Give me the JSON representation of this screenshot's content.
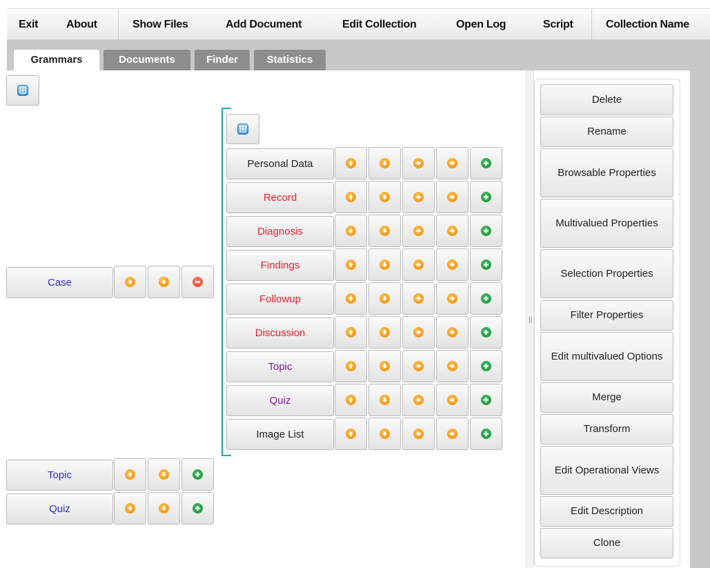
{
  "menu": {
    "items": [
      "Exit",
      "About",
      "Show Files",
      "Add Document",
      "Edit Collection",
      "Open Log",
      "Script",
      "Collection Name"
    ]
  },
  "tabs": [
    "Grammars",
    "Documents",
    "Finder",
    "Statistics"
  ],
  "active_tab": "Grammars",
  "root_nodes": [
    {
      "label": "Case",
      "color": "#2d2dcc",
      "actions": [
        "move-up",
        "move-down",
        "remove"
      ]
    },
    {
      "label": "Topic",
      "color": "#2d2dcc",
      "actions": [
        "move-up",
        "move-down",
        "add"
      ]
    },
    {
      "label": "Quiz",
      "color": "#2d2dcc",
      "actions": [
        "move-up",
        "move-down",
        "add"
      ]
    }
  ],
  "child_nodes": [
    {
      "label": "Personal Data",
      "color": "#222222"
    },
    {
      "label": "Record",
      "color": "#e8212a"
    },
    {
      "label": "Diagnosis",
      "color": "#e8212a"
    },
    {
      "label": "Findings",
      "color": "#e8212a"
    },
    {
      "label": "Followup",
      "color": "#e8212a"
    },
    {
      "label": "Discussion",
      "color": "#e8212a"
    },
    {
      "label": "Topic",
      "color": "#7c1fa0"
    },
    {
      "label": "Quiz",
      "color": "#7c1fa0"
    },
    {
      "label": "Image List",
      "color": "#222222"
    }
  ],
  "child_actions": [
    "move-up",
    "move-down",
    "move-left",
    "move-right",
    "add"
  ],
  "side_buttons": [
    "Delete",
    "Rename",
    "Browsable Properties",
    "Multivalued Properties",
    "Selection Properties",
    "Filter Properties",
    "Edit multivalued Options",
    "Merge",
    "Transform",
    "Edit Operational Views",
    "Edit Description",
    "Clone"
  ],
  "splitter_grip": "||"
}
